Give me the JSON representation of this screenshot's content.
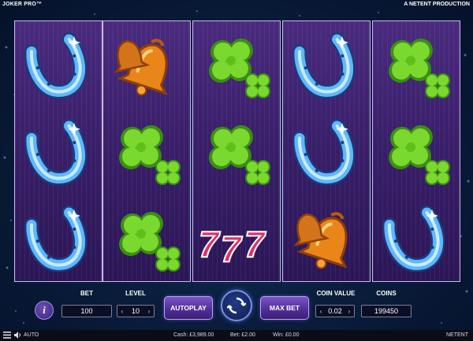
{
  "header": {
    "game_title": "JOKER PRO™",
    "producer": "A NETENT PRODUCTION"
  },
  "reels": [
    [
      "horseshoe",
      "horseshoe",
      "horseshoe"
    ],
    [
      "bell",
      "clover",
      "clover"
    ],
    [
      "clover",
      "clover",
      "seven"
    ],
    [
      "horseshoe",
      "horseshoe",
      "bell"
    ],
    [
      "clover",
      "clover",
      "horseshoe"
    ]
  ],
  "controls": {
    "info_label": "i",
    "bet": {
      "label": "BET",
      "value": "100"
    },
    "level": {
      "label": "LEVEL",
      "value": "10",
      "dec": "‹",
      "inc": "›"
    },
    "autoplay_label": "AUTOPLAY",
    "spin_icon": "spin-arrows-icon",
    "max_bet_label": "MAX BET",
    "coin_value": {
      "label": "COIN VALUE",
      "value": "0.02",
      "dec": "‹",
      "inc": "›"
    },
    "coins": {
      "label": "COINS",
      "value": "199450"
    }
  },
  "footer": {
    "menu_icon": "hamburger-icon",
    "sound_icon": "speaker-icon",
    "auto_label": "AUTO",
    "cash": "Cash: £3,989.00",
    "bet": "Bet: £2.00",
    "win": "Win: £0.00",
    "brand": "NETENT"
  },
  "colors": {
    "reel_top": "#4a2b7e",
    "reel_bottom": "#2b1656",
    "button_purple": "#52309a",
    "horseshoe_blue": "#5fb7ff",
    "clover_green": "#6fd02a",
    "bell_orange": "#f0901a",
    "seven_pink": "#e0306a"
  }
}
